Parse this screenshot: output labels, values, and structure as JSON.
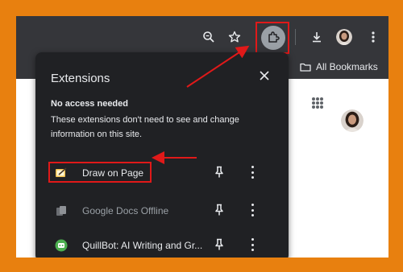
{
  "bookmarks_bar": {
    "all_bookmarks_label": "All Bookmarks"
  },
  "toolbar_icons": [
    "zoom-icon",
    "star-icon",
    "puzzle-icon",
    "download-icon",
    "avatar",
    "more-vert-icon"
  ],
  "extensions_panel": {
    "title": "Extensions",
    "section_heading": "No access needed",
    "section_description": "These extensions don't need to see and change information on this site.",
    "items": [
      {
        "label": "Draw on Page",
        "icon": "draw-on-page-icon",
        "highlighted": true,
        "dimmed": false
      },
      {
        "label": "Google Docs Offline",
        "icon": "google-docs-offline-icon",
        "highlighted": false,
        "dimmed": true
      },
      {
        "label": "QuillBot: AI Writing and Gr...",
        "icon": "quillbot-icon",
        "highlighted": false,
        "dimmed": false
      }
    ]
  },
  "colors": {
    "annotation_red": "#e01919",
    "frame_orange": "#e8800f",
    "panel_bg": "#202124"
  }
}
